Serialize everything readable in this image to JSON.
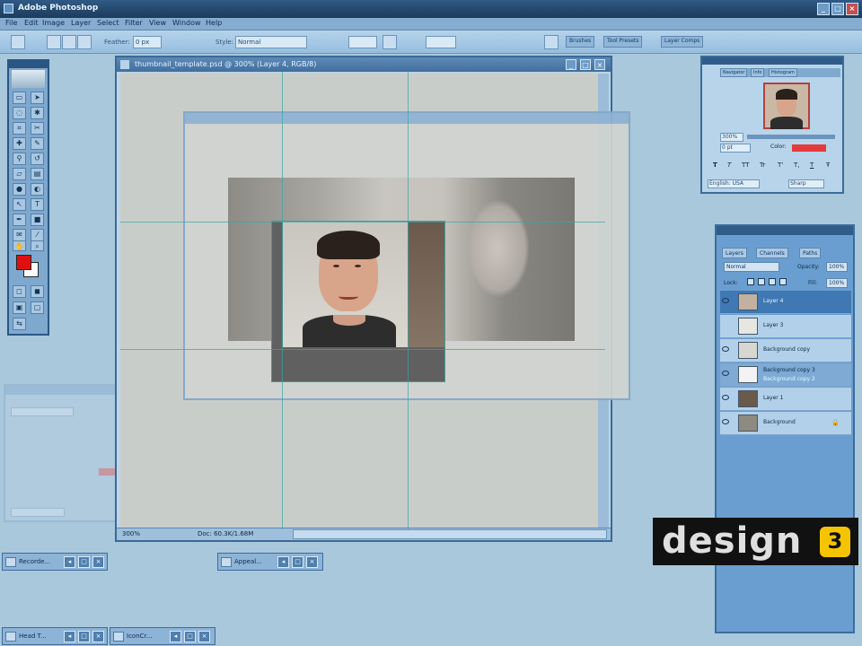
{
  "app": {
    "title": "Adobe Photoshop"
  },
  "menu": [
    "File",
    "Edit",
    "Image",
    "Layer",
    "Select",
    "Filter",
    "View",
    "Window",
    "Help"
  ],
  "options": {
    "feather_label": "Feather:",
    "feather_value": "0 px",
    "style_label": "Style:",
    "style_value": "Normal",
    "panel_tabs": [
      "Brushes",
      "Tool Presets",
      "Layer Comps"
    ]
  },
  "document": {
    "title": "thumbnail_template.psd @ 300% (Layer 4, RGB/8)",
    "zoom": "300%",
    "status": "Doc: 60.3K/1.68M"
  },
  "navigator": {
    "tabs": [
      "Navigator",
      "Info",
      "Histogram"
    ],
    "zoom": "300%",
    "size_value": "0 pt",
    "color_label": "Color:",
    "color_value": "#e53a3a",
    "language": "English: USA",
    "antialias": "Sharp",
    "style_buttons": [
      "T",
      "T",
      "TT",
      "Tr",
      "T'",
      "T,",
      "T",
      "Ŧ"
    ]
  },
  "layers": {
    "tabs": [
      "Layers",
      "Channels",
      "Paths"
    ],
    "blend_mode": "Normal",
    "opacity_label": "Opacity:",
    "opacity_value": "100%",
    "lock_label": "Lock:",
    "fill_label": "Fill:",
    "fill_value": "100%",
    "items": [
      {
        "name": "Layer 4",
        "selected": true
      },
      {
        "name": "Layer 3",
        "selected": false
      },
      {
        "name": "Background copy",
        "selected": false
      },
      {
        "name": "Background copy 3",
        "sub": "Background copy 2",
        "selected": false
      },
      {
        "name": "Layer 1",
        "selected": false
      },
      {
        "name": "Background",
        "selected": false
      }
    ]
  },
  "minimized": [
    {
      "label": "Recorde..."
    },
    {
      "label": "Appeal..."
    },
    {
      "label": "Head T..."
    },
    {
      "label": "IconCr..."
    }
  ],
  "brand": {
    "wordmark": "design",
    "badge": "3"
  }
}
